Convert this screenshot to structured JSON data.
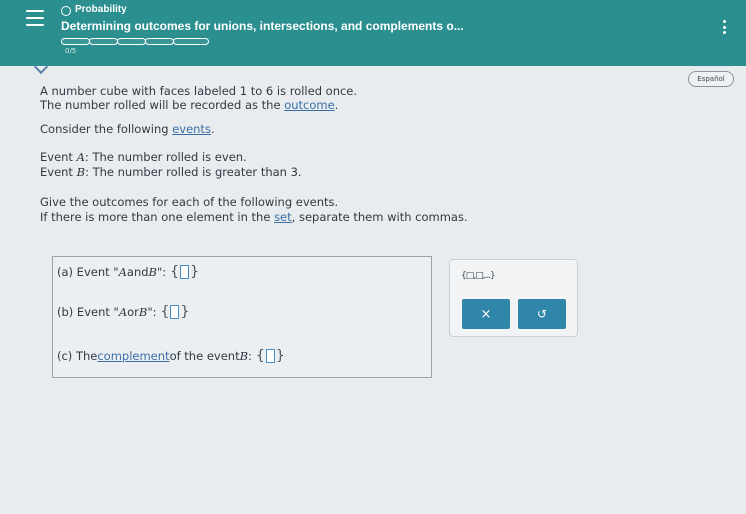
{
  "header": {
    "topic": "Probability",
    "title": "Determining outcomes for unions, intersections, and complements o...",
    "progress_label": "0/5"
  },
  "language_button": "Español",
  "problem": {
    "line1": "A number cube with faces labeled 1 to 6 is rolled once.",
    "line2_prefix": "The number rolled will be recorded as the ",
    "line2_link": "outcome",
    "line2_suffix": ".",
    "line3_prefix": "Consider the following ",
    "line3_link": "events",
    "line3_suffix": ".",
    "eventA_prefix": "Event ",
    "eventA_var": "A",
    "eventA_text": ": The number rolled is even.",
    "eventB_prefix": "Event ",
    "eventB_var": "B",
    "eventB_text": ": The number rolled is greater than 3.",
    "instr1": "Give the outcomes for each of the following events.",
    "instr2_prefix": "If there is more than one element in the ",
    "instr2_link": "set",
    "instr2_suffix": ", separate them with commas."
  },
  "parts": {
    "a_prefix": "(a) Event \"",
    "a_var1": "A",
    "a_mid": " and ",
    "a_var2": "B",
    "a_suffix": "\":",
    "b_prefix": "(b) Event \"",
    "b_var1": "A",
    "b_mid": " or ",
    "b_var2": "B",
    "b_suffix": "\":",
    "c_prefix": "(c) The ",
    "c_link": "complement",
    "c_mid": " of the event ",
    "c_var": "B",
    "c_suffix": ":"
  },
  "braces": {
    "open": "{",
    "close": "}"
  },
  "tools": {
    "set_tool": "{□,□,...}",
    "clear": "×",
    "undo": "↺"
  }
}
